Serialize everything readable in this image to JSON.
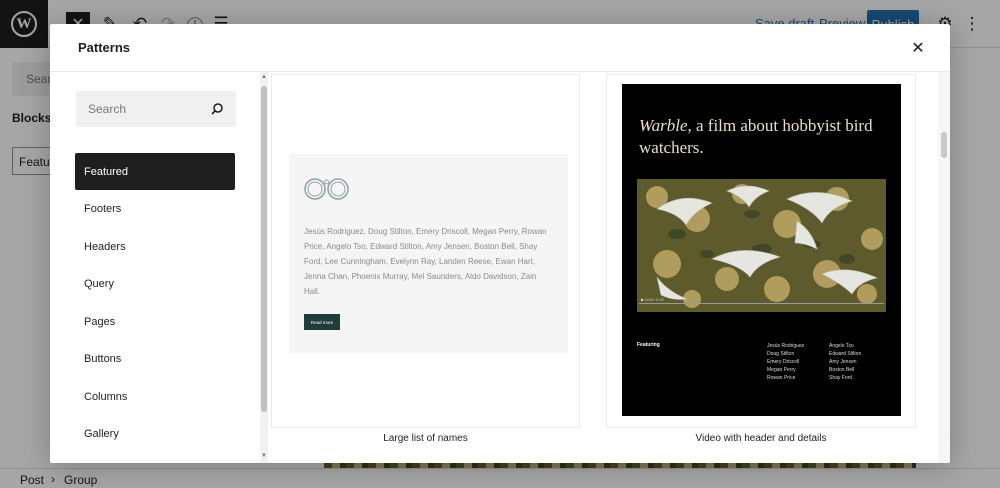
{
  "editor": {
    "save_draft": "Save draft",
    "preview": "Preview",
    "publish": "Publish",
    "left_search": "Search",
    "left_blocks": "Blocks",
    "left_featured": "Featured",
    "breadcrumb": [
      "Post",
      "Group"
    ]
  },
  "modal": {
    "title": "Patterns",
    "close_icon": "close-icon",
    "search_placeholder": "Search",
    "categories": [
      "Featured",
      "Footers",
      "Headers",
      "Query",
      "Pages",
      "Buttons",
      "Columns",
      "Gallery"
    ],
    "active_category": "Featured",
    "patterns": [
      {
        "label": "Large list of names",
        "names": "Jesús Rodriguez, Doug Stilton, Emery Driscoll, Megan Perry, Rowan Price, Angelo Tso, Edward Stilton, Amy Jensen, Boston Bell, Shay Ford, Lee Cunningham, Evelynn Ray, Landen Reese, Ewan Hart, Jenna Chan, Phoenix Murray, Mel Saunders, Aldo Davidson, Zain Hall.",
        "button": "Read more"
      },
      {
        "label": "Video with header and details",
        "title_italic": "Warble",
        "title_rest": ", a film about hobbyist bird watchers.",
        "featuring": "Featuring",
        "col1": [
          "Jesús Rodriguez",
          "Doug Stilton",
          "Emery Driscoll",
          "Megan Perry",
          "Rowan Price"
        ],
        "col2": [
          "Angelo Tso",
          "Edward Stilton",
          "Amy Jensen",
          "Boston Bell",
          "Shay Ford"
        ],
        "video_time": "0:00 / 0:47"
      }
    ]
  },
  "colors": {
    "accent": "#2271b1",
    "dark": "#1e1e1e",
    "readmore_bg": "#1f3b3c",
    "title_cream": "#e9dfc8"
  }
}
